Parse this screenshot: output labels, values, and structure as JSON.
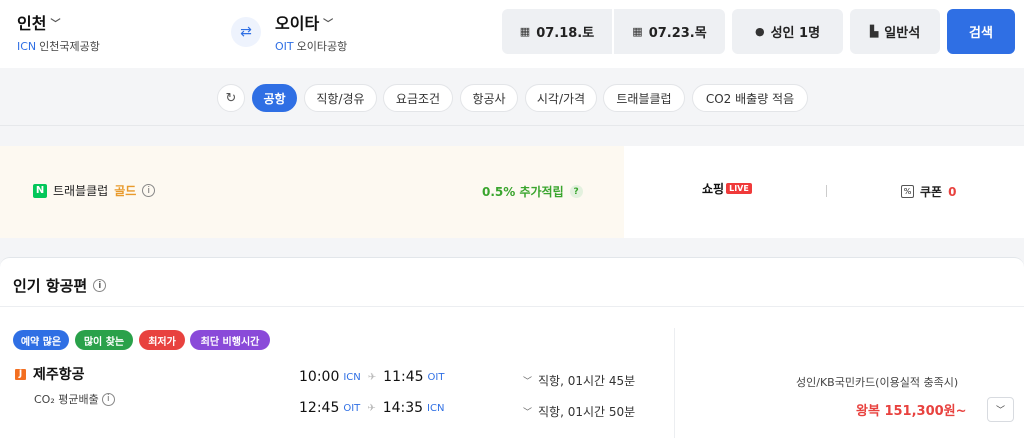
{
  "route": {
    "origin": {
      "city": "인천",
      "code": "ICN",
      "airport": "인천국제공항"
    },
    "destination": {
      "city": "오이타",
      "code": "OIT",
      "airport": "오이타공항"
    }
  },
  "search_bar": {
    "depart_date": "07.18.토",
    "return_date": "07.23.목",
    "passengers": "성인 1명",
    "cabin": "일반석",
    "search_label": "검색"
  },
  "filters": [
    "공항",
    "직항/경유",
    "요금조건",
    "항공사",
    "시각/가격",
    "트래블클럽",
    "CO2 배출량 적음"
  ],
  "promo": {
    "badge": "N",
    "club_label": "트래블클럽",
    "club_tier": "골드",
    "accrual": "0.5% 추가적립",
    "shopping_label": "쇼핑",
    "live_label": "LIVE",
    "coupon_label": "쿠폰",
    "coupon_count": "0"
  },
  "popular": {
    "title": "인기 항공편",
    "tags": [
      {
        "label": "예약 많은",
        "color": "#2f6fe4"
      },
      {
        "label": "많이 찾는",
        "color": "#2aa14a"
      },
      {
        "label": "최저가",
        "color": "#e8423f"
      },
      {
        "label": "최단 비행시간",
        "color": "#8a4ad9"
      }
    ],
    "flight": {
      "airline": "제주항공",
      "logo_char": "J",
      "co2_label": "CO₂ 평균배출",
      "outbound": {
        "depart_time": "10:00",
        "depart_code": "ICN",
        "arrive_time": "11:45",
        "arrive_code": "OIT",
        "duration": "직항, 01시간 45분"
      },
      "inbound": {
        "depart_time": "12:45",
        "depart_code": "OIT",
        "arrive_time": "14:35",
        "arrive_code": "ICN",
        "duration": "직항, 01시간 50분"
      },
      "card_note": "성인/KB국민카드(이용실적 충족시)",
      "price": "왕복 151,300원~"
    }
  },
  "icons": {
    "swap": "swap-arrows-icon",
    "calendar": "calendar-icon",
    "person": "person-icon",
    "seat": "seat-icon",
    "refresh": "refresh-icon",
    "info": "info-icon",
    "plane": "plane-icon",
    "chevron": "chevron-down-icon"
  }
}
